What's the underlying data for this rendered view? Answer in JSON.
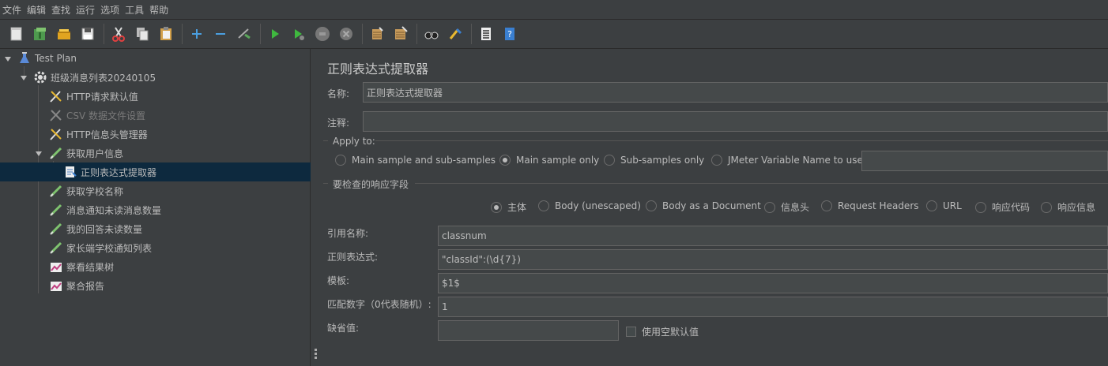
{
  "menu": [
    "文件",
    "编辑",
    "查找",
    "运行",
    "选项",
    "工具",
    "帮助"
  ],
  "toolbar_icons": [
    "new-icon",
    "templates-icon",
    "open-icon",
    "save-icon",
    "cut-icon",
    "copy-icon",
    "paste-icon",
    "expand-icon",
    "collapse-icon",
    "toggle-icon",
    "start-icon",
    "start-no-pause-icon",
    "stop-icon",
    "shutdown-icon",
    "clear-icon",
    "clear-all-icon",
    "search-icon",
    "reset-search-icon",
    "function-helper-icon",
    "help-icon"
  ],
  "tree": {
    "root": "Test Plan",
    "thread_group": "班级消息列表20240105",
    "items": [
      {
        "label": "HTTP请求默认值",
        "icon": "wrench-icon",
        "disabled": false
      },
      {
        "label": "CSV 数据文件设置",
        "icon": "wrench-icon",
        "disabled": true
      },
      {
        "label": "HTTP信息头管理器",
        "icon": "wrench-icon",
        "disabled": false
      },
      {
        "label": "获取用户信息",
        "icon": "sampler-icon",
        "disabled": false
      },
      {
        "label": "正则表达式提取器",
        "icon": "extractor-icon",
        "disabled": false
      },
      {
        "label": "获取学校名称",
        "icon": "sampler-icon",
        "disabled": false
      },
      {
        "label": "消息通知未读消息数量",
        "icon": "sampler-icon",
        "disabled": false
      },
      {
        "label": "我的回答未读数量",
        "icon": "sampler-icon",
        "disabled": false
      },
      {
        "label": "家长端学校通知列表",
        "icon": "sampler-icon",
        "disabled": false
      },
      {
        "label": "察看结果树",
        "icon": "listener-icon",
        "disabled": false
      },
      {
        "label": "聚合报告",
        "icon": "listener-icon",
        "disabled": false
      }
    ]
  },
  "panel": {
    "title": "正则表达式提取器",
    "name_label": "名称:",
    "name_value": "正则表达式提取器",
    "comment_label": "注释:",
    "comment_value": "",
    "apply_to": {
      "legend": "Apply to:",
      "options": [
        "Main sample and sub-samples",
        "Main sample only",
        "Sub-samples only",
        "JMeter Variable Name to use"
      ],
      "selected": 1,
      "variable_value": ""
    },
    "field_to_check": {
      "legend": "要检查的响应字段",
      "options": [
        "主体",
        "Body (unescaped)",
        "Body as a Document",
        "信息头",
        "Request Headers",
        "URL",
        "响应代码",
        "响应信息"
      ],
      "selected": 0
    },
    "ref_name_label": "引用名称:",
    "ref_name_value": "classnum",
    "regex_label": "正则表达式:",
    "regex_value": "\"classId\":(\\d{7})",
    "template_label": "模板:",
    "template_value": "$1$",
    "match_no_label": "匹配数字（0代表随机）:",
    "match_no_value": "1",
    "default_label": "缺省值:",
    "default_value": "",
    "use_empty_label": "使用空默认值",
    "use_empty_checked": false
  }
}
